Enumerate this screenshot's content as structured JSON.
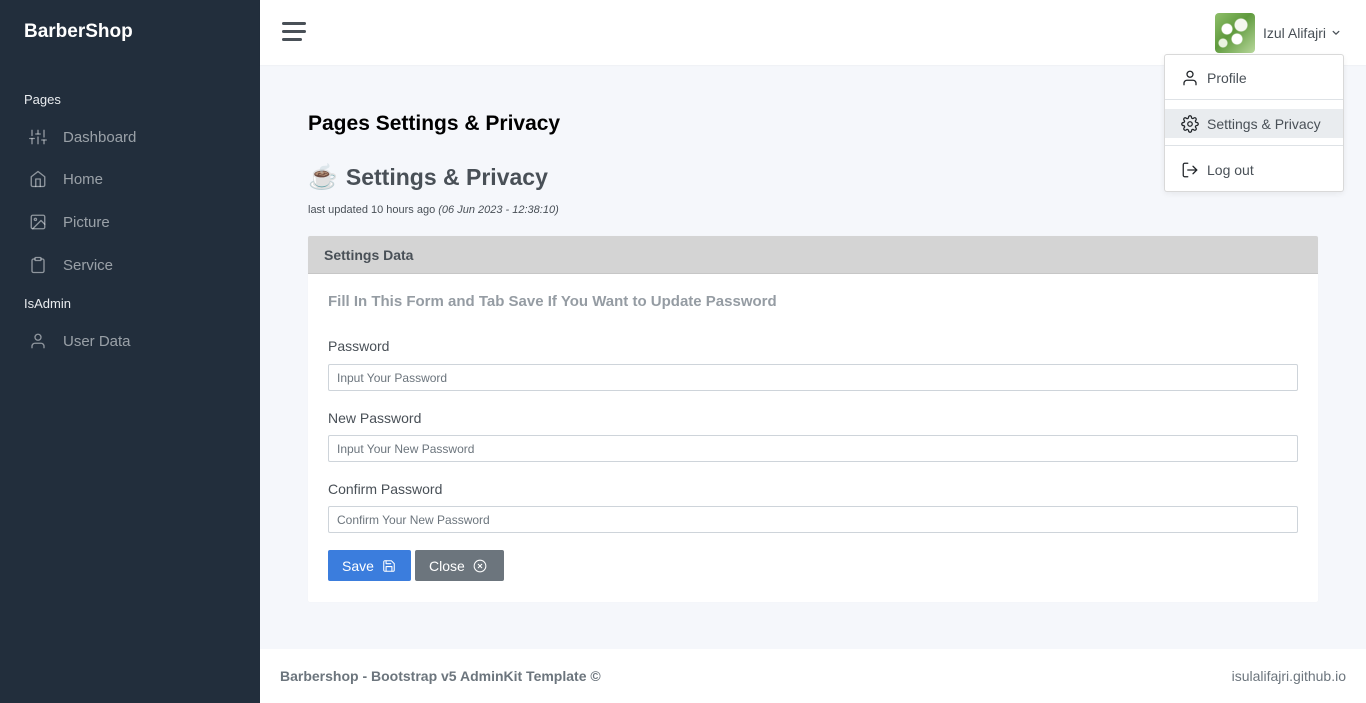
{
  "sidebar": {
    "brand": "BarberShop",
    "sections": [
      {
        "header": "Pages"
      },
      {
        "header": "IsAdmin"
      }
    ],
    "items": [
      {
        "label": "Dashboard",
        "icon": "sliders-icon"
      },
      {
        "label": "Home",
        "icon": "home-icon"
      },
      {
        "label": "Picture",
        "icon": "image-icon"
      },
      {
        "label": "Service",
        "icon": "clipboard-icon"
      },
      {
        "label": "User Data",
        "icon": "user-icon"
      }
    ]
  },
  "topbar": {
    "user_name": "Izul Alifajri"
  },
  "dropdown": {
    "items": [
      {
        "label": "Profile",
        "icon": "user-icon"
      },
      {
        "label": "Settings & Privacy",
        "icon": "gear-icon",
        "active": true
      },
      {
        "label": "Log out",
        "icon": "log-out-icon"
      }
    ]
  },
  "page": {
    "heading_bold": "Pages",
    "heading_rest": " Settings & Privacy",
    "sub_emoji": "☕",
    "sub_heading": "Settings & Privacy",
    "updated_text": "last updated 10 hours ago ",
    "updated_date": "(06 Jun 2023 - 12:38:10)"
  },
  "card": {
    "header": "Settings Data",
    "title": "Fill In This Form and Tab Save If You Want to Update Password",
    "fields": [
      {
        "label": "Password",
        "placeholder": "Input Your Password",
        "value": ""
      },
      {
        "label": "New Password",
        "placeholder": "Input Your New Password",
        "value": ""
      },
      {
        "label": "Confirm Password",
        "placeholder": "Confirm Your New Password",
        "value": ""
      }
    ],
    "save_label": "Save",
    "close_label": "Close"
  },
  "footer": {
    "left": "Barbershop - Bootstrap v5 AdminKit Template ©",
    "right": "isulalifajri.github.io"
  },
  "colors": {
    "sidebar_bg": "#222e3c",
    "primary": "#3b7ddd",
    "secondary": "#6c757d",
    "card_header_bg": "#d4d4d4",
    "page_bg": "#f5f7fb"
  }
}
